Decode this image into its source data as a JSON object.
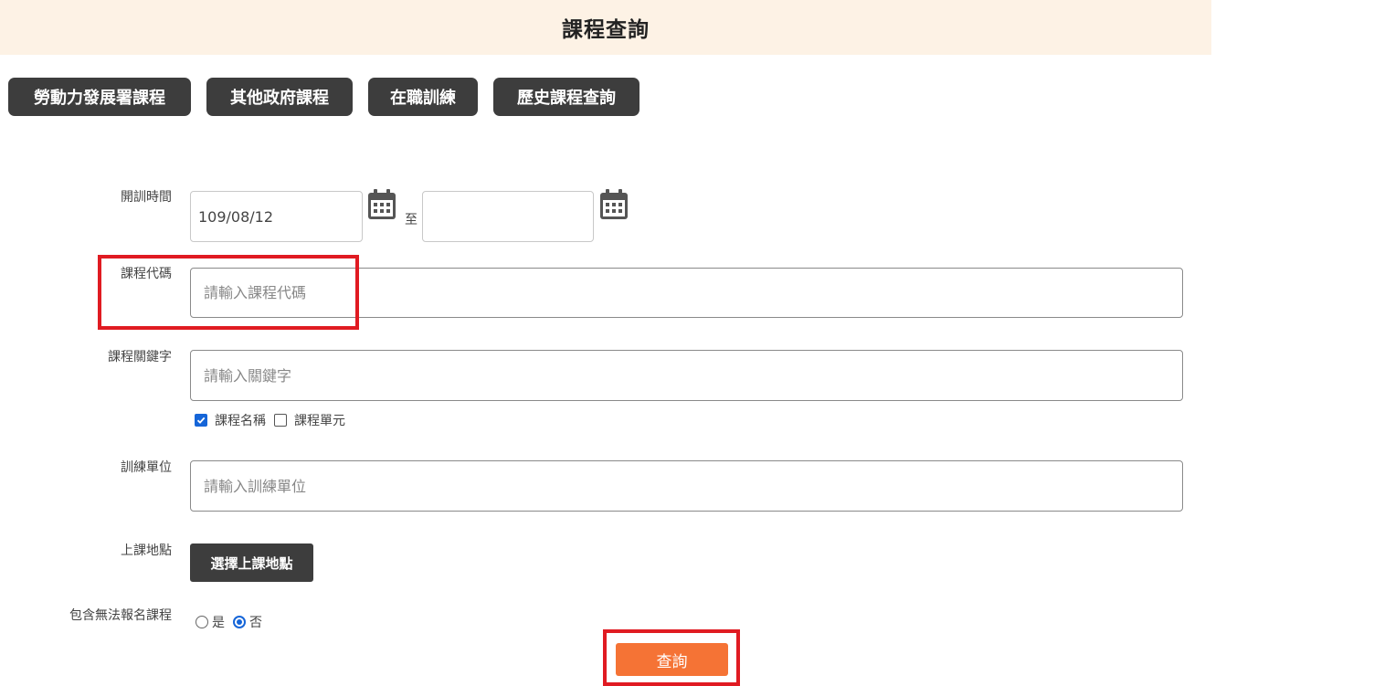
{
  "header": {
    "title": "課程查詢"
  },
  "tabs": [
    {
      "label": "勞動力發展署課程"
    },
    {
      "label": "其他政府課程"
    },
    {
      "label": "在職訓練"
    },
    {
      "label": "歷史課程查詢"
    }
  ],
  "form": {
    "date": {
      "label": "開訓時間",
      "start_value": "109/08/12",
      "end_value": "",
      "separator": "至",
      "icon": "calendar-icon"
    },
    "course_code": {
      "label": "課程代碼",
      "placeholder": "請輸入課程代碼",
      "value": ""
    },
    "keyword": {
      "label": "課程關鍵字",
      "placeholder": "請輸入關鍵字",
      "value": "",
      "options": [
        {
          "label": "課程名稱",
          "checked": true
        },
        {
          "label": "課程單元",
          "checked": false
        }
      ]
    },
    "training_unit": {
      "label": "訓練單位",
      "placeholder": "請輸入訓練單位",
      "value": ""
    },
    "location": {
      "label": "上課地點",
      "button_label": "選擇上課地點"
    },
    "include_unavailable": {
      "label": "包含無法報名課程",
      "options": [
        {
          "label": "是",
          "selected": false
        },
        {
          "label": "否",
          "selected": true
        }
      ]
    }
  },
  "search_button": {
    "label": "查詢"
  },
  "colors": {
    "header_bg": "#fdf2e5",
    "tab_bg": "#3d3d3d",
    "search_bg": "#f57335",
    "highlight": "#e01b22",
    "check_blue": "#1565d8"
  }
}
